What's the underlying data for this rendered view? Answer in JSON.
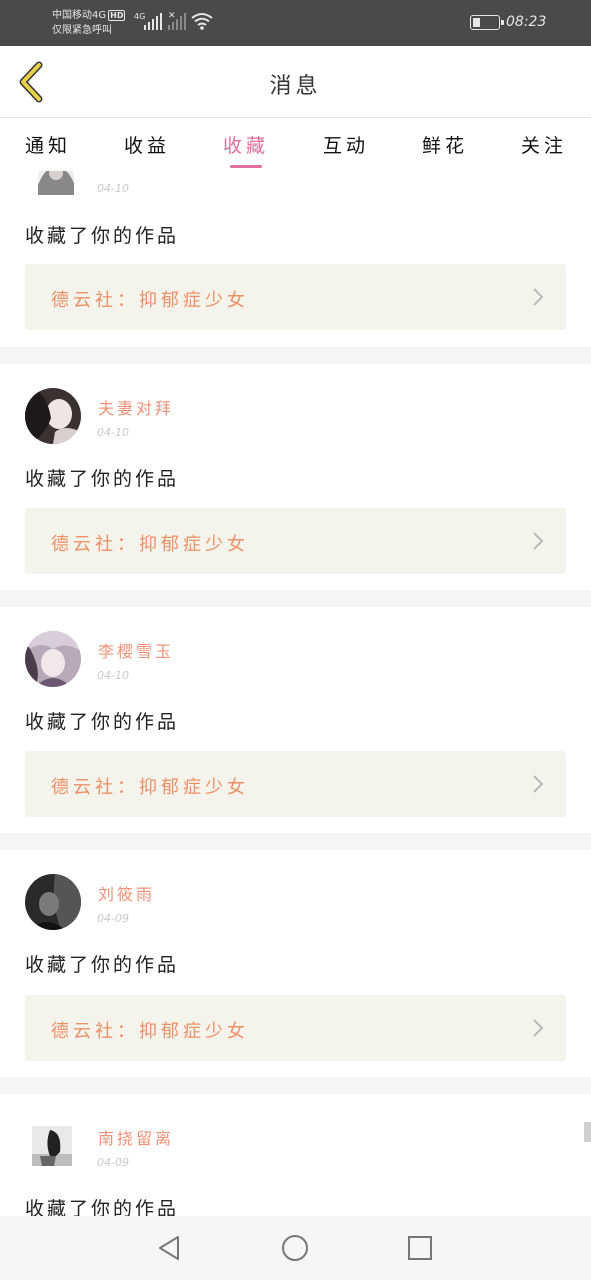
{
  "status_bar": {
    "carrier_line1": "中国移动4G",
    "hd_badge": "HD",
    "carrier_line2": "仅限紧急呼叫",
    "network": "4G",
    "time": "08:23",
    "battery_level": 0.25
  },
  "header": {
    "title": "消息",
    "back_icon": "chevron-left-icon"
  },
  "tabs": [
    {
      "label": "通知",
      "active": false
    },
    {
      "label": "收益",
      "active": false
    },
    {
      "label": "收藏",
      "active": true
    },
    {
      "label": "互动",
      "active": false
    },
    {
      "label": "鲜花",
      "active": false
    },
    {
      "label": "关注",
      "active": false
    }
  ],
  "notifications": [
    {
      "user": "",
      "date": "04-10",
      "action": "收藏了你的作品",
      "work": "德云社：抑郁症少女"
    },
    {
      "user": "夫妻对拜",
      "date": "04-10",
      "action": "收藏了你的作品",
      "work": "德云社：抑郁症少女"
    },
    {
      "user": "李樱雪玉",
      "date": "04-10",
      "action": "收藏了你的作品",
      "work": "德云社：抑郁症少女"
    },
    {
      "user": "刘筱雨",
      "date": "04-09",
      "action": "收藏了你的作品",
      "work": "德云社：抑郁症少女"
    },
    {
      "user": "南挠留离",
      "date": "04-09",
      "action": "收藏了你的作品",
      "work": ""
    }
  ],
  "colors": {
    "accent": "#e36f9f",
    "username": "#f0927a",
    "work_title": "#ef9066",
    "work_bg": "#f4f4ec",
    "status_bar": "#4a4a4a",
    "back_icon": "#e8d24a"
  },
  "navbar": {
    "back_icon": "triangle-back-icon",
    "home_icon": "circle-home-icon",
    "recents_icon": "square-recents-icon"
  }
}
